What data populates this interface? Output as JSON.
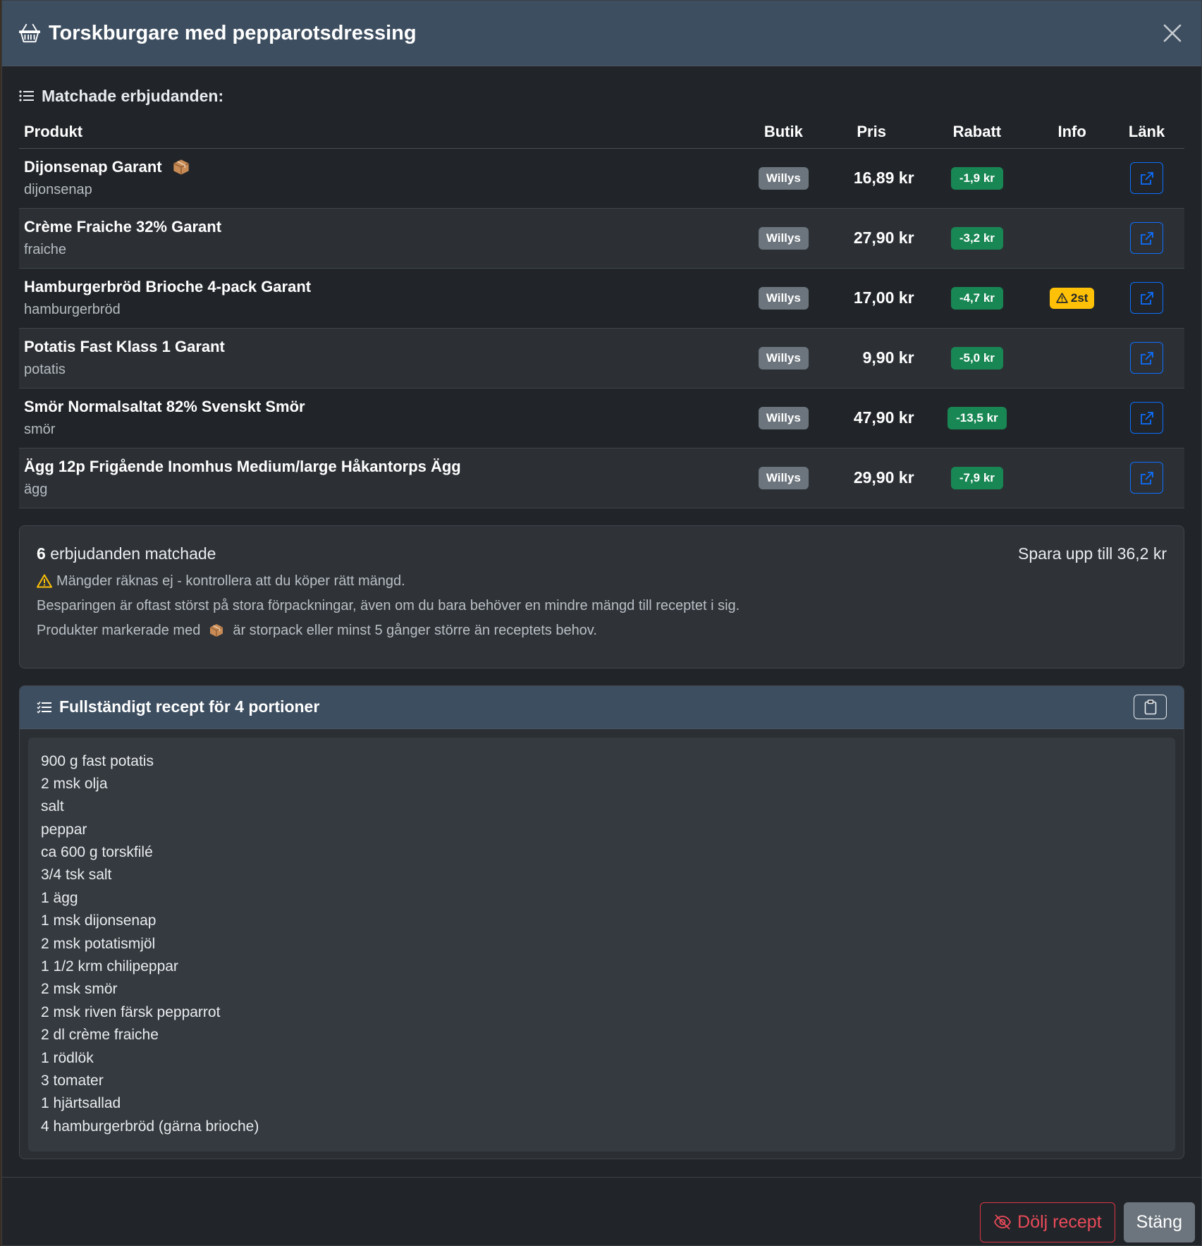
{
  "modal": {
    "title": "Torskburgare med pepparotsdressing",
    "title_icon": "basket-icon",
    "close_icon": "close-icon"
  },
  "offers": {
    "heading": "Matchade erbjudanden:",
    "heading_icon": "list-icon",
    "columns": [
      "Produkt",
      "Butik",
      "Pris",
      "Rabatt",
      "Info",
      "Länk"
    ],
    "rows": [
      {
        "name": "Dijonsenap Garant",
        "sub": "dijonsenap",
        "bulk": true,
        "shop": "Willys",
        "price": "16,89 kr",
        "discount": "-1,9 kr",
        "info": ""
      },
      {
        "name": "Crème Fraiche 32% Garant",
        "sub": "fraiche",
        "bulk": false,
        "shop": "Willys",
        "price": "27,90 kr",
        "discount": "-3,2 kr",
        "info": ""
      },
      {
        "name": "Hamburgerbröd Brioche 4-pack Garant",
        "sub": "hamburgerbröd",
        "bulk": false,
        "shop": "Willys",
        "price": "17,00 kr",
        "discount": "-4,7 kr",
        "info": "2st"
      },
      {
        "name": "Potatis Fast Klass 1 Garant",
        "sub": "potatis",
        "bulk": false,
        "shop": "Willys",
        "price": "9,90 kr",
        "discount": "-5,0 kr",
        "info": ""
      },
      {
        "name": "Smör Normalsaltat 82% Svenskt Smör",
        "sub": "smör",
        "bulk": false,
        "shop": "Willys",
        "price": "47,90 kr",
        "discount": "-13,5 kr",
        "info": ""
      },
      {
        "name": "Ägg 12p Frigående Inomhus Medium/large Håkantorps Ägg",
        "sub": "ägg",
        "bulk": false,
        "shop": "Willys",
        "price": "29,90 kr",
        "discount": "-7,9 kr",
        "info": ""
      }
    ]
  },
  "summary": {
    "count": "6",
    "count_label": "erbjudanden matchade",
    "savings": "Spara upp till 36,2 kr",
    "warning": "Mängder räknas ej - kontrollera att du köper rätt mängd.",
    "note1": "Besparingen är oftast störst på stora förpackningar, även om du bara behöver en mindre mängd till receptet i sig.",
    "note2_before": "Produkter markerade med",
    "note2_after": "är storpack eller minst 5 gånger större än receptets behov."
  },
  "recipe": {
    "title": "Fullständigt recept för 4 portioner",
    "copy_icon": "clipboard-icon",
    "ingredients": [
      "900 g fast potatis",
      "2 msk olja",
      "salt",
      "peppar",
      "ca 600 g torskfilé",
      "3/4 tsk salt",
      "1 ägg",
      "1 msk dijonsenap",
      "2 msk potatismjöl",
      "1 1/2 krm chilipeppar",
      "2 msk smör",
      "2 msk riven färsk pepparrot",
      "2 dl crème fraiche",
      "1 rödlök",
      "3 tomater",
      "1 hjärtsallad",
      "4 hamburgerbröd (gärna brioche)"
    ]
  },
  "footer": {
    "hide_label": "Dölj recept",
    "hide_icon": "eye-slash-icon",
    "close_label": "Stäng"
  },
  "colors": {
    "header_bg": "#3d4e60",
    "modal_bg": "#212529",
    "shop_badge": "#6c757d",
    "discount_badge": "#198754",
    "warning": "#ffc107",
    "link": "#0d6efd",
    "danger": "#dc3545"
  }
}
